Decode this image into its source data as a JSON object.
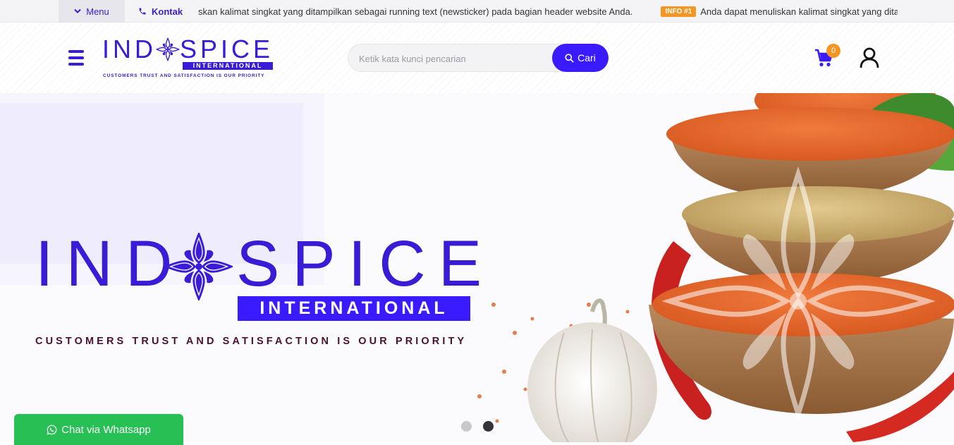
{
  "topbar": {
    "menu_label": "Menu",
    "kontak_label": "Kontak",
    "ticker_text_1": "skan kalimat singkat yang ditampilkan sebagai running text (newsticker) pada bagian header website Anda.",
    "ticker_badge": "INFO #1",
    "ticker_text_2": "Anda dapat menuliskan kalimat singkat yang ditampilkan sebagai running text"
  },
  "header": {
    "logo_word_left": "IND",
    "logo_word_right": "SPICE",
    "logo_sub": "INTERNATIONAL",
    "logo_tagline": "CUSTOMERS TRUST AND SATISFACTION IS OUR PRIORITY",
    "search_placeholder": "Ketik kata kunci pencarian",
    "search_button": "Cari",
    "cart_count": "0"
  },
  "hero": {
    "logo_word_left": "IND",
    "logo_word_right": "SPICE",
    "logo_sub": "INTERNATIONAL",
    "logo_tagline": "CUSTOMERS TRUST AND SATISFACTION IS OUR PRIORITY",
    "slides_total": 2,
    "active_slide": 2
  },
  "whatsapp": {
    "label": "Chat via Whatsapp"
  },
  "colors": {
    "brand": "#3a1bd6",
    "accent_button": "#3a1bff",
    "badge": "#f49623",
    "whatsapp": "#27c054",
    "tagline": "#4a1030"
  },
  "icons": {
    "menu": "chevron-down-icon",
    "kontak": "phone-icon",
    "hamburger": "hamburger-icon",
    "search": "search-icon",
    "cart": "cart-icon",
    "user": "user-icon",
    "whatsapp": "whatsapp-icon",
    "logo_mark": "flower-logo-icon"
  }
}
